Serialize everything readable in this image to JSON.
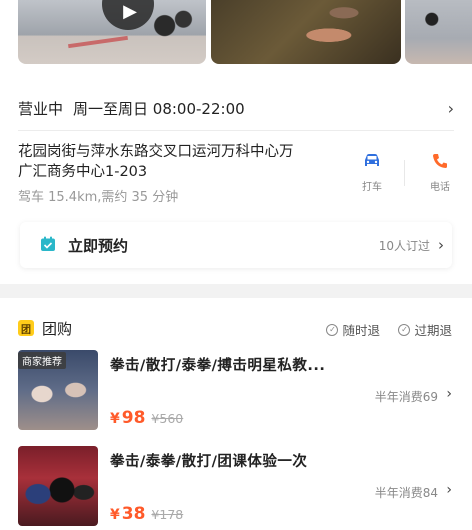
{
  "gallery": {
    "play_icon": "play-icon",
    "photos": [
      "video-thumbnail",
      "photo-2",
      "photo-3"
    ]
  },
  "hours": {
    "status": "营业中",
    "schedule": "周一至周日 08:00-22:00"
  },
  "address": {
    "line1": "花园岗街与萍水东路交叉口运河万科中心万",
    "line2": "广汇商务中心1-203",
    "distance": "驾车 15.4km,需约 35 分钟"
  },
  "actions": {
    "drive_label": "打车",
    "call_label": "电话",
    "drive_icon": "car-icon",
    "call_icon": "phone-icon",
    "drive_color": "#2f6fde",
    "call_color": "#ff6a2a"
  },
  "reservation": {
    "label": "立即预约",
    "count": "10人订过",
    "icon": "calendar-icon",
    "icon_color": "#2ab7c9"
  },
  "group_buy": {
    "badge": "团",
    "title": "团购",
    "policy_1": "随时退",
    "policy_2": "过期退",
    "accent_color": "#ffcc1a",
    "deals": [
      {
        "tag": "商家推荐",
        "title": "拳击/散打/泰拳/搏击明星私教...",
        "sales": "半年消费69",
        "currency": "¥",
        "price": "98",
        "original": "¥560"
      },
      {
        "title": "拳击/泰拳/散打/团课体验一次",
        "sales": "半年消费84",
        "currency": "¥",
        "price": "38",
        "original": "¥178"
      }
    ]
  },
  "colors": {
    "price": "#ff5a2a",
    "page_bg": "#f2f2f2"
  }
}
